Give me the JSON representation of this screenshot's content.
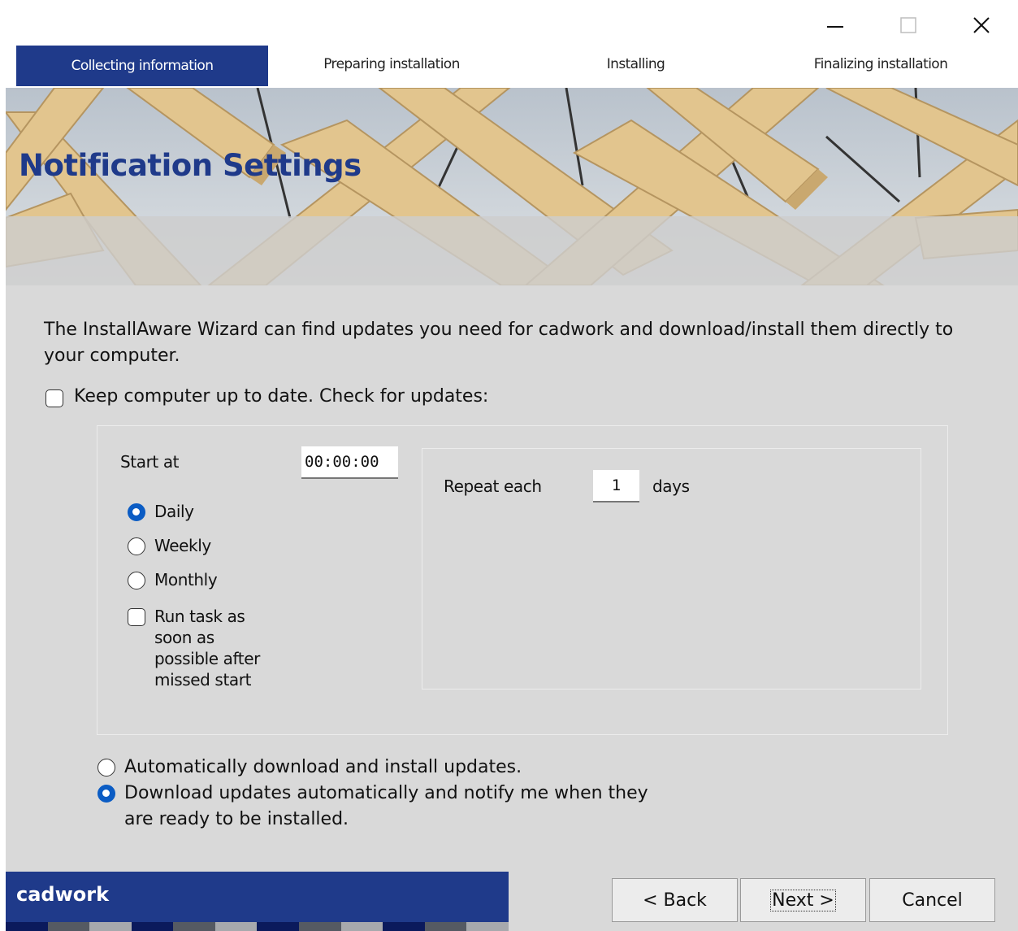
{
  "window": {
    "minimize_icon": "minimize-icon",
    "maximize_icon": "maximize-icon",
    "close_icon": "close-icon"
  },
  "steps": [
    {
      "label": "Collecting information",
      "active": true
    },
    {
      "label": "Preparing installation",
      "active": false
    },
    {
      "label": "Installing",
      "active": false
    },
    {
      "label": "Finalizing installation",
      "active": false
    }
  ],
  "header": {
    "title": "Notification Settings"
  },
  "content": {
    "description_line1": "The InstallAware Wizard can find updates you need for cadwork and download/install them directly to",
    "description_line2": "your computer.",
    "keep_updated_label": "Keep computer up to date. Check for updates:",
    "keep_updated_checked": false,
    "schedule": {
      "start_at_label": "Start at",
      "start_at_value": "00:00:00",
      "frequency_options": [
        {
          "label": "Daily",
          "selected": true
        },
        {
          "label": "Weekly",
          "selected": false
        },
        {
          "label": "Monthly",
          "selected": false
        }
      ],
      "run_missed_lines": [
        "Run task as",
        "soon as",
        "possible after",
        "missed start"
      ],
      "run_missed_checked": false,
      "repeat_label": "Repeat each",
      "repeat_value": "1",
      "repeat_unit": "days"
    },
    "update_modes": [
      {
        "label": "Automatically download and install updates.",
        "selected": false
      },
      {
        "label_line1": "Download updates automatically and notify me when they",
        "label_line2": "are ready to be installed.",
        "selected": true
      }
    ]
  },
  "footer": {
    "brand": "cadwork",
    "back_label": "< Back",
    "next_label": "Next >",
    "cancel_label": "Cancel"
  },
  "colors": {
    "accent": "#1f3a8a",
    "radio_selected": "#0b5cc4",
    "background": "#d9d9d9"
  }
}
